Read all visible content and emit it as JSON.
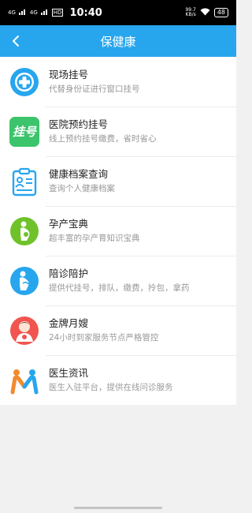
{
  "status_bar": {
    "net1": "4G",
    "net2": "4G",
    "hd": "HD",
    "time": "10:40",
    "speed_value": "99.7",
    "speed_unit": "KB/s",
    "battery": "48"
  },
  "header": {
    "title": "保健康",
    "back_icon": "chevron-left-icon"
  },
  "colors": {
    "accent": "#27a6ee",
    "green": "#3cc46c",
    "lime": "#6fc22a",
    "red": "#f0554f",
    "orange": "#f28a2e"
  },
  "services": [
    {
      "title": "现场挂号",
      "subtitle": "代替身份证进行窗口挂号",
      "icon": "plus-circle-icon"
    },
    {
      "title": "医院预约挂号",
      "subtitle": "线上预约挂号缴费，省时省心",
      "icon": "registration-icon",
      "icon_text": "挂号"
    },
    {
      "title": "健康档案查询",
      "subtitle": "查询个人健康档案",
      "icon": "clipboard-icon"
    },
    {
      "title": "孕产宝典",
      "subtitle": "超丰富的孕产育知识宝典",
      "icon": "pregnancy-icon"
    },
    {
      "title": "陪诊陪护",
      "subtitle": "提供代挂号，排队，缴费，拎包，拿药",
      "icon": "caregiver-icon"
    },
    {
      "title": "金牌月嫂",
      "subtitle": "24小时到家服务节点严格管控",
      "icon": "nanny-icon"
    },
    {
      "title": "医生资讯",
      "subtitle": "医生入驻平台，提供在线问诊服务",
      "icon": "doctor-m-icon"
    }
  ]
}
